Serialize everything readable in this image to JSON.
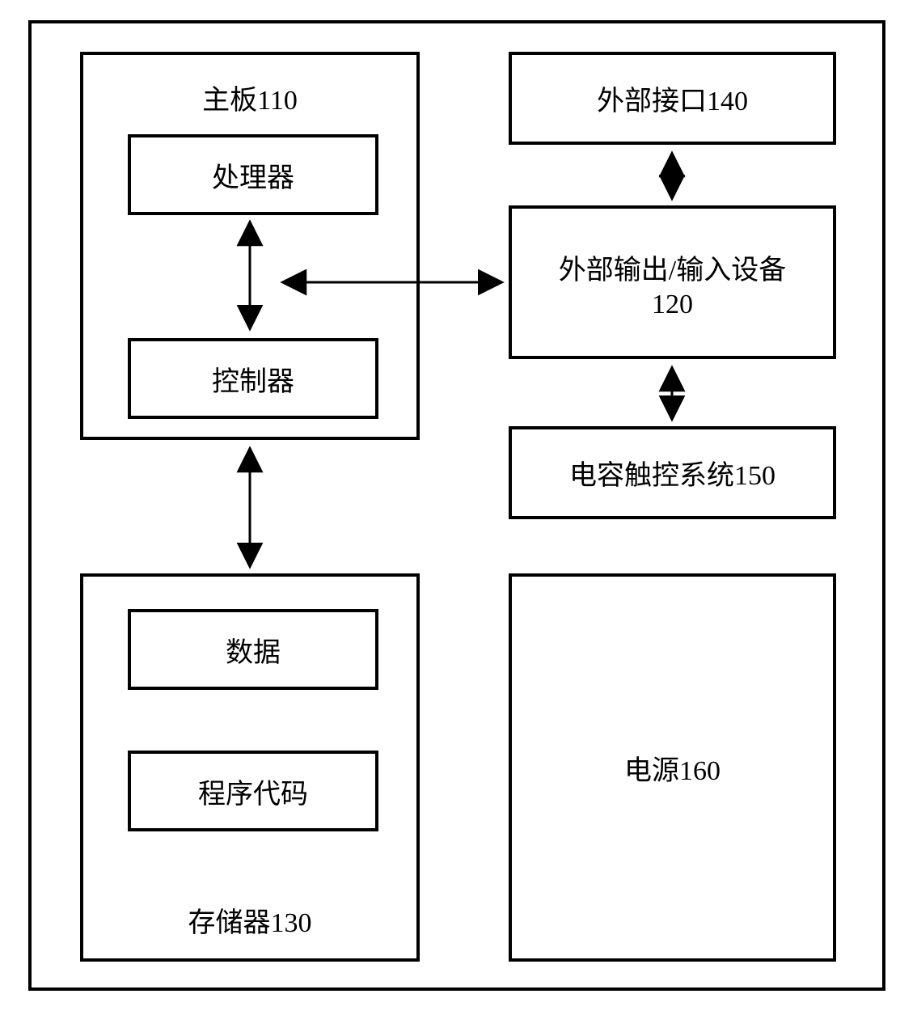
{
  "blocks": {
    "motherboard": {
      "label": "主板110"
    },
    "processor": {
      "label": "处理器"
    },
    "controller": {
      "label": "控制器"
    },
    "extInterface": {
      "label": "外部接口140"
    },
    "ioDevice": {
      "line1": "外部输出/输入设备",
      "line2": "120"
    },
    "touchSystem": {
      "label": "电容触控系统150"
    },
    "memory": {
      "label": "存储器130"
    },
    "data": {
      "label": "数据"
    },
    "programCode": {
      "label": "程序代码"
    },
    "power": {
      "label": "电源160"
    }
  }
}
